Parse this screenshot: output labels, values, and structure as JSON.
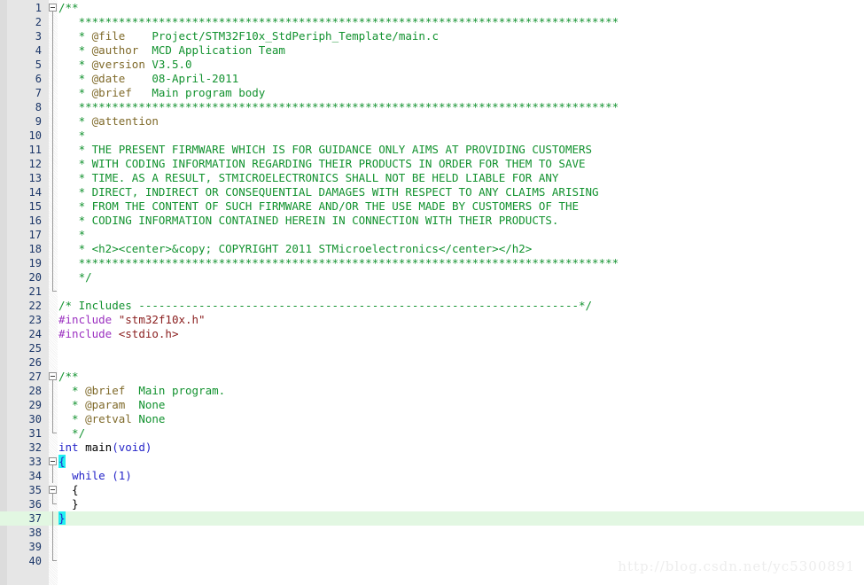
{
  "editor": {
    "first_line": 1,
    "last_line": 40,
    "current_line": 37,
    "colors": {
      "comment": "#12922f",
      "doc_tag": "#7f6a2a",
      "preprocessor": "#9b30c0",
      "string": "#8b2020",
      "keyword": "#2424c8",
      "line_number": "#1b3668",
      "gutter_bg": "#e6e6e6",
      "current_line_bg": "#e2f7e2",
      "brace_match_bg": "#22f0f0",
      "editor_bg": "#ffffff"
    }
  },
  "watermark": {
    "text": "http://blog.csdn.net/yc5300891"
  },
  "lines": [
    {
      "n": 1,
      "fold": "open",
      "tokens": [
        {
          "t": "/**",
          "c": "c-comment"
        }
      ]
    },
    {
      "n": 2,
      "fold": "line",
      "tokens": [
        {
          "t": "   *********************************************************************************",
          "c": "c-comment"
        }
      ]
    },
    {
      "n": 3,
      "fold": "line",
      "tokens": [
        {
          "t": "   * ",
          "c": "c-comment"
        },
        {
          "t": "@file",
          "c": "c-doctag"
        },
        {
          "t": "    Project/STM32F10x_StdPeriph_Template/main.c",
          "c": "c-comment"
        }
      ]
    },
    {
      "n": 4,
      "fold": "line",
      "tokens": [
        {
          "t": "   * ",
          "c": "c-comment"
        },
        {
          "t": "@author",
          "c": "c-doctag"
        },
        {
          "t": "  MCD Application Team",
          "c": "c-comment"
        }
      ]
    },
    {
      "n": 5,
      "fold": "line",
      "tokens": [
        {
          "t": "   * ",
          "c": "c-comment"
        },
        {
          "t": "@version",
          "c": "c-doctag"
        },
        {
          "t": " V3.5.0",
          "c": "c-comment"
        }
      ]
    },
    {
      "n": 6,
      "fold": "line",
      "tokens": [
        {
          "t": "   * ",
          "c": "c-comment"
        },
        {
          "t": "@date",
          "c": "c-doctag"
        },
        {
          "t": "    08-April-2011",
          "c": "c-comment"
        }
      ]
    },
    {
      "n": 7,
      "fold": "line",
      "tokens": [
        {
          "t": "   * ",
          "c": "c-comment"
        },
        {
          "t": "@brief",
          "c": "c-doctag"
        },
        {
          "t": "   Main program body",
          "c": "c-comment"
        }
      ]
    },
    {
      "n": 8,
      "fold": "line",
      "tokens": [
        {
          "t": "   *********************************************************************************",
          "c": "c-comment"
        }
      ]
    },
    {
      "n": 9,
      "fold": "line",
      "tokens": [
        {
          "t": "   * ",
          "c": "c-comment"
        },
        {
          "t": "@attention",
          "c": "c-doctag"
        }
      ]
    },
    {
      "n": 10,
      "fold": "line",
      "tokens": [
        {
          "t": "   *",
          "c": "c-comment"
        }
      ]
    },
    {
      "n": 11,
      "fold": "line",
      "tokens": [
        {
          "t": "   * THE PRESENT FIRMWARE WHICH IS FOR GUIDANCE ONLY AIMS AT PROVIDING CUSTOMERS",
          "c": "c-comment"
        }
      ]
    },
    {
      "n": 12,
      "fold": "line",
      "tokens": [
        {
          "t": "   * WITH CODING INFORMATION REGARDING THEIR PRODUCTS IN ORDER FOR THEM TO SAVE",
          "c": "c-comment"
        }
      ]
    },
    {
      "n": 13,
      "fold": "line",
      "tokens": [
        {
          "t": "   * TIME. AS A RESULT, STMICROELECTRONICS SHALL NOT BE HELD LIABLE FOR ANY",
          "c": "c-comment"
        }
      ]
    },
    {
      "n": 14,
      "fold": "line",
      "tokens": [
        {
          "t": "   * DIRECT, INDIRECT OR CONSEQUENTIAL DAMAGES WITH RESPECT TO ANY CLAIMS ARISING",
          "c": "c-comment"
        }
      ]
    },
    {
      "n": 15,
      "fold": "line",
      "tokens": [
        {
          "t": "   * FROM THE CONTENT OF SUCH FIRMWARE AND/OR THE USE MADE BY CUSTOMERS OF THE",
          "c": "c-comment"
        }
      ]
    },
    {
      "n": 16,
      "fold": "line",
      "tokens": [
        {
          "t": "   * CODING INFORMATION CONTAINED HEREIN IN CONNECTION WITH THEIR PRODUCTS.",
          "c": "c-comment"
        }
      ]
    },
    {
      "n": 17,
      "fold": "line",
      "tokens": [
        {
          "t": "   *",
          "c": "c-comment"
        }
      ]
    },
    {
      "n": 18,
      "fold": "line",
      "tokens": [
        {
          "t": "   * <h2><center>&copy; COPYRIGHT 2011 STMicroelectronics</center></h2>",
          "c": "c-comment"
        }
      ]
    },
    {
      "n": 19,
      "fold": "line",
      "tokens": [
        {
          "t": "   *********************************************************************************",
          "c": "c-comment"
        }
      ]
    },
    {
      "n": 20,
      "fold": "line",
      "tokens": [
        {
          "t": "   */",
          "c": "c-comment"
        }
      ]
    },
    {
      "n": 21,
      "fold": "end",
      "tokens": []
    },
    {
      "n": 22,
      "fold": "none",
      "tokens": [
        {
          "t": "/* Includes ------------------------------------------------------------------*/",
          "c": "c-comment"
        }
      ]
    },
    {
      "n": 23,
      "fold": "none",
      "tokens": [
        {
          "t": "#include",
          "c": "c-pre"
        },
        {
          "t": " ",
          "c": "c-plain"
        },
        {
          "t": "\"stm32f10x.h\"",
          "c": "c-str"
        }
      ]
    },
    {
      "n": 24,
      "fold": "none",
      "tokens": [
        {
          "t": "#include",
          "c": "c-pre"
        },
        {
          "t": " ",
          "c": "c-plain"
        },
        {
          "t": "<stdio.h>",
          "c": "c-str"
        }
      ]
    },
    {
      "n": 25,
      "fold": "none",
      "tokens": []
    },
    {
      "n": 26,
      "fold": "none",
      "tokens": []
    },
    {
      "n": 27,
      "fold": "open",
      "tokens": [
        {
          "t": "/**",
          "c": "c-comment"
        }
      ]
    },
    {
      "n": 28,
      "fold": "line",
      "tokens": [
        {
          "t": "  * ",
          "c": "c-comment"
        },
        {
          "t": "@brief",
          "c": "c-doctag"
        },
        {
          "t": "  Main program.",
          "c": "c-comment"
        }
      ]
    },
    {
      "n": 29,
      "fold": "line",
      "tokens": [
        {
          "t": "  * ",
          "c": "c-comment"
        },
        {
          "t": "@param",
          "c": "c-doctag"
        },
        {
          "t": "  None",
          "c": "c-comment"
        }
      ]
    },
    {
      "n": 30,
      "fold": "line",
      "tokens": [
        {
          "t": "  * ",
          "c": "c-comment"
        },
        {
          "t": "@retval",
          "c": "c-doctag"
        },
        {
          "t": " None",
          "c": "c-comment"
        }
      ]
    },
    {
      "n": 31,
      "fold": "end",
      "tokens": [
        {
          "t": "  */",
          "c": "c-comment"
        }
      ]
    },
    {
      "n": 32,
      "fold": "none",
      "tokens": [
        {
          "t": "int",
          "c": "c-kw"
        },
        {
          "t": " main",
          "c": "c-plain"
        },
        {
          "t": "(",
          "c": "c-punct"
        },
        {
          "t": "void",
          "c": "c-kw"
        },
        {
          "t": ")",
          "c": "c-punct"
        }
      ]
    },
    {
      "n": 33,
      "fold": "open",
      "tokens": [
        {
          "t": "{",
          "c": "brace-match"
        }
      ]
    },
    {
      "n": 34,
      "fold": "line",
      "tokens": [
        {
          "t": "  ",
          "c": "c-plain"
        },
        {
          "t": "while",
          "c": "c-kw"
        },
        {
          "t": " ",
          "c": "c-plain"
        },
        {
          "t": "(",
          "c": "c-punct"
        },
        {
          "t": "1",
          "c": "c-num"
        },
        {
          "t": ")",
          "c": "c-punct"
        }
      ]
    },
    {
      "n": 35,
      "fold": "open",
      "tokens": [
        {
          "t": "  {",
          "c": "c-plain"
        }
      ]
    },
    {
      "n": 36,
      "fold": "end",
      "tokens": [
        {
          "t": "  }",
          "c": "c-plain"
        }
      ]
    },
    {
      "n": 37,
      "fold": "line",
      "current": true,
      "tokens": [
        {
          "t": "}",
          "c": "brace-match"
        }
      ]
    },
    {
      "n": 38,
      "fold": "line",
      "tokens": []
    },
    {
      "n": 39,
      "fold": "line",
      "tokens": []
    },
    {
      "n": 40,
      "fold": "end",
      "tokens": []
    }
  ]
}
